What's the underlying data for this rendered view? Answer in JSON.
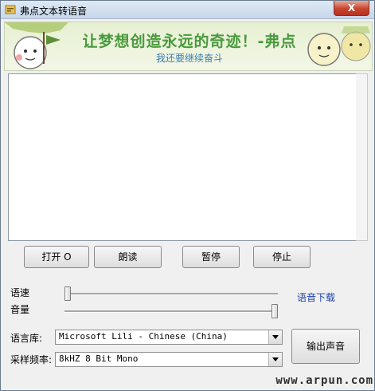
{
  "window": {
    "title": "弗点文本转语音",
    "close_glyph": "X"
  },
  "banner": {
    "title": "让梦想创造永远的奇迹！-弗点",
    "subtitle": "我还要继续奋斗"
  },
  "editor": {
    "text": ""
  },
  "buttons": {
    "open": "打开 O",
    "read": "朗读",
    "pause": "暂停",
    "stop": "停止",
    "output": "输出声音"
  },
  "controls": {
    "speed_label": "语速",
    "volume_label": "音量",
    "download_link": "语音下载",
    "speed_level": 0.0,
    "volume_level": 1.0
  },
  "voice": {
    "label": "语言库:",
    "selected": "Microsoft Lili - Chinese (China)"
  },
  "sample_rate": {
    "label": "采样频率:",
    "selected": "8kHZ 8 Bit Mono"
  },
  "watermark": "www.arpun.com",
  "colors": {
    "banner_title": "#4a9a3e",
    "banner_subtitle": "#3a7fb0",
    "link": "#1c3fa8",
    "close_button": "#c7442f"
  }
}
